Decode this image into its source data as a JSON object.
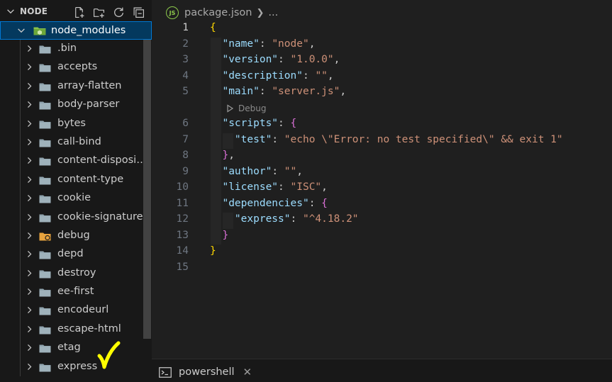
{
  "explorer": {
    "title": "NODE",
    "actions": [
      "new-file-icon",
      "new-folder-icon",
      "refresh-icon",
      "collapse-all-icon"
    ],
    "root_folder": "node_modules",
    "items": [
      {
        "label": ".bin"
      },
      {
        "label": "accepts"
      },
      {
        "label": "array-flatten"
      },
      {
        "label": "body-parser"
      },
      {
        "label": "bytes"
      },
      {
        "label": "call-bind"
      },
      {
        "label": "content-dispositi..."
      },
      {
        "label": "content-type"
      },
      {
        "label": "cookie"
      },
      {
        "label": "cookie-signature"
      },
      {
        "label": "debug"
      },
      {
        "label": "depd"
      },
      {
        "label": "destroy"
      },
      {
        "label": "ee-first"
      },
      {
        "label": "encodeurl"
      },
      {
        "label": "escape-html"
      },
      {
        "label": "etag"
      },
      {
        "label": "express"
      }
    ]
  },
  "editor": {
    "file_name": "package.json",
    "breadcrumb_more": "...",
    "codelens": "Debug",
    "lines": [
      {
        "n": "1",
        "text": "{"
      },
      {
        "n": "2",
        "key": "\"name\"",
        "value": "\"node\"",
        "tail": ","
      },
      {
        "n": "3",
        "key": "\"version\"",
        "value": "\"1.0.0\"",
        "tail": ","
      },
      {
        "n": "4",
        "key": "\"description\"",
        "value": "\"\"",
        "tail": ","
      },
      {
        "n": "5",
        "key": "\"main\"",
        "value": "\"server.js\"",
        "tail": ","
      },
      {
        "n": "6",
        "key": "\"scripts\"",
        "open": "{"
      },
      {
        "n": "7",
        "key": "\"test\"",
        "value": "\"echo \\\"Error: no test specified\\\" && exit 1\""
      },
      {
        "n": "8",
        "close": "}",
        "tail": ","
      },
      {
        "n": "9",
        "key": "\"author\"",
        "value": "\"\"",
        "tail": ","
      },
      {
        "n": "10",
        "key": "\"license\"",
        "value": "\"ISC\"",
        "tail": ","
      },
      {
        "n": "11",
        "key": "\"dependencies\"",
        "open": "{"
      },
      {
        "n": "12",
        "key": "\"express\"",
        "value": "\"^4.18.2\""
      },
      {
        "n": "13",
        "close": "}"
      },
      {
        "n": "14",
        "text": "}"
      },
      {
        "n": "15",
        "text": ""
      }
    ]
  },
  "panel": {
    "terminal_name": "powershell",
    "close_glyph": "✕"
  },
  "colors": {
    "selection": "#04395e",
    "focus_border": "#0078d4",
    "key": "#9cdcfe",
    "string": "#ce9178",
    "brace": "#ffd700",
    "check_mark": "#ffff00"
  }
}
